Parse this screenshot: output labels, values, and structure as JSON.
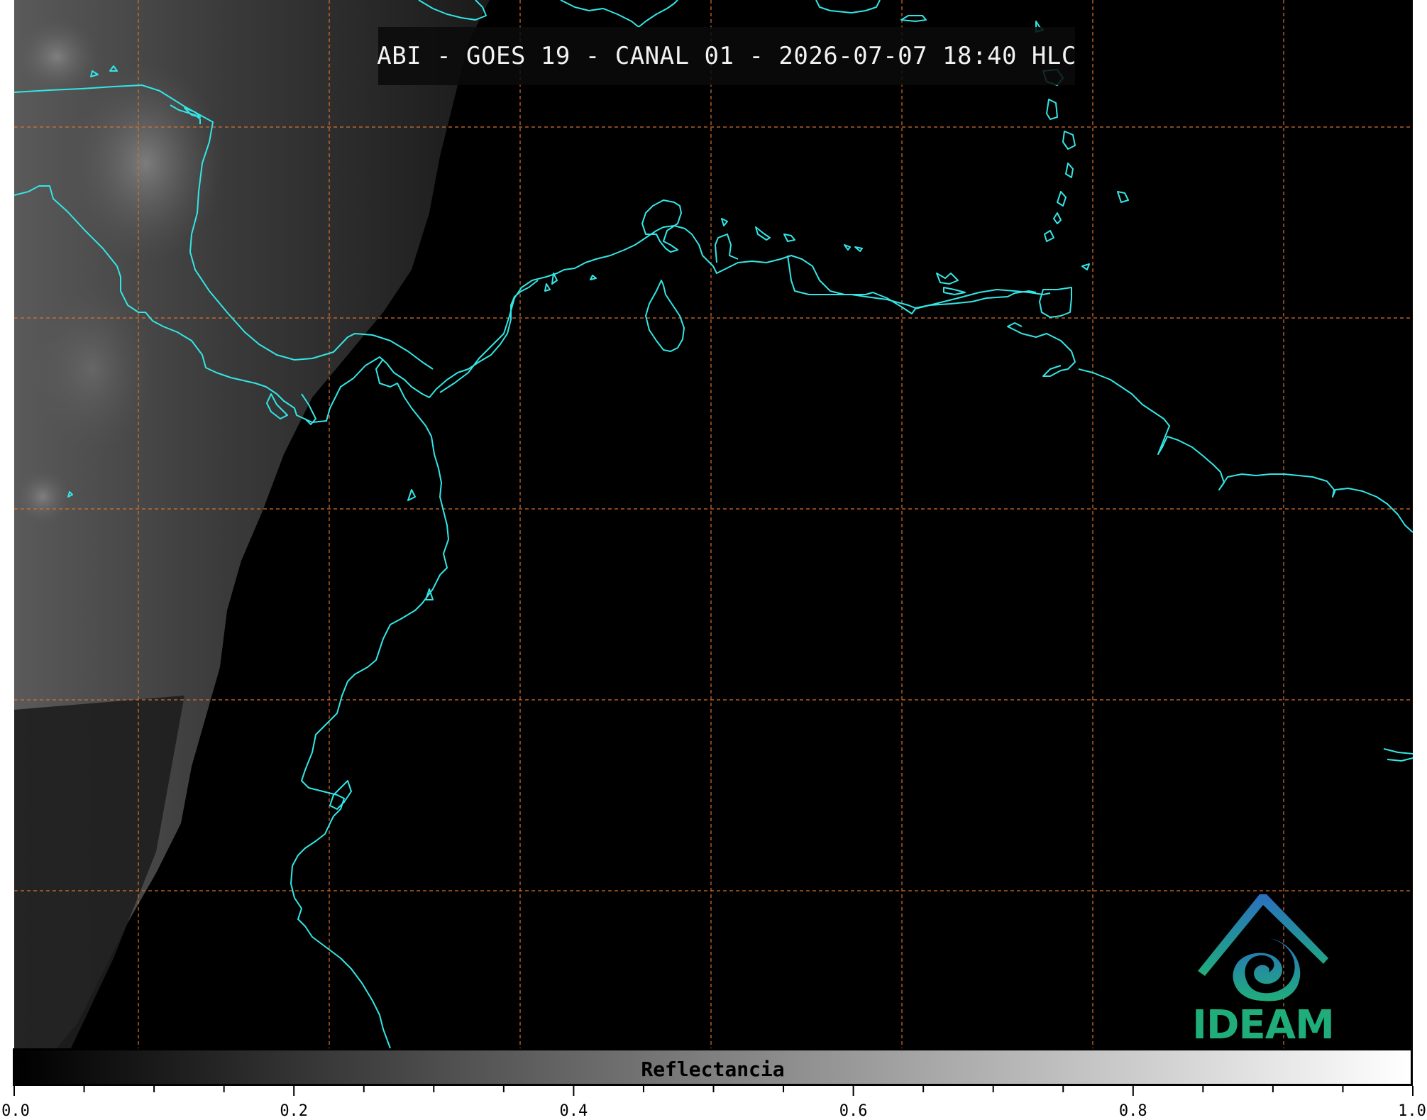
{
  "title": "ABI - GOES 19 - CANAL 01 - 2026-07-07 18:40 HLC",
  "colors": {
    "coastline": "#33e6e6",
    "graticule": "#d9722b",
    "background": "#000000",
    "logo_green": "#1fae7a",
    "logo_blue": "#2a7fb5"
  },
  "logo": {
    "text": "IDEAM",
    "icon": "ideam-logo-icon"
  },
  "colorbar": {
    "label": "Reflectancia",
    "min": 0.0,
    "max": 1.0,
    "tick_labels": [
      "0.0",
      "0.2",
      "0.4",
      "0.6",
      "0.8",
      "1.0"
    ]
  }
}
